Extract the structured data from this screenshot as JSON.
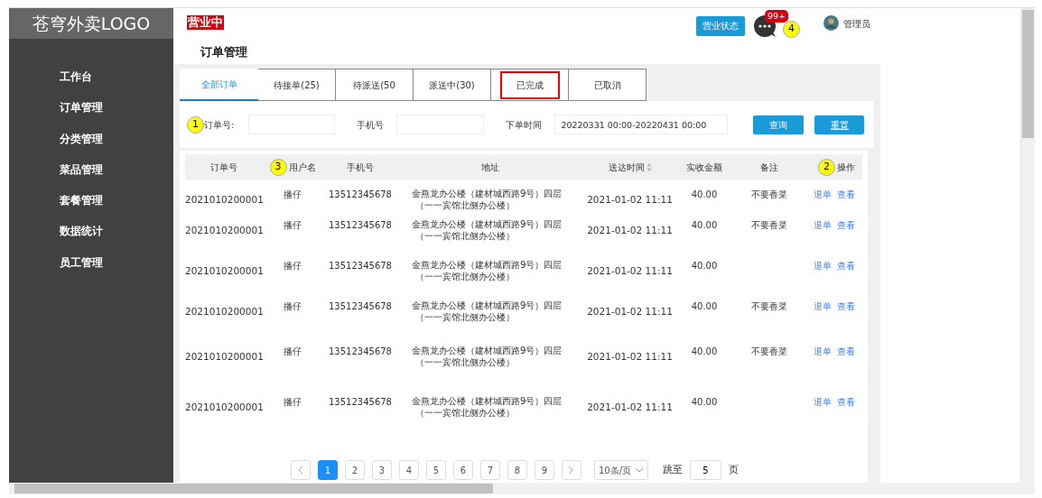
{
  "sidebar": {
    "logo": "苍穹外卖LOGO",
    "items": [
      {
        "label": "工作台",
        "selected": false
      },
      {
        "label": "订单管理",
        "selected": false
      },
      {
        "label": "分类管理",
        "selected": false
      },
      {
        "label": "菜品管理",
        "selected": false
      },
      {
        "label": "套餐管理",
        "selected": false
      },
      {
        "label": "数据统计",
        "selected": false
      },
      {
        "label": "员工管理",
        "selected": false
      }
    ]
  },
  "header": {
    "status_tag": "营业中",
    "page_title": "订单管理",
    "status_button": "营业状态",
    "message_badge": "99+",
    "user": "管理员"
  },
  "tabs": [
    {
      "label": "全部订单",
      "selected": true,
      "marked": false
    },
    {
      "label": "待接单(25)",
      "selected": false,
      "marked": false
    },
    {
      "label": "待派送(50",
      "selected": false,
      "marked": false
    },
    {
      "label": "派送中(30)",
      "selected": false,
      "marked": false
    },
    {
      "label": "已完成",
      "selected": false,
      "marked": true
    },
    {
      "label": "已取消",
      "selected": false,
      "marked": false
    }
  ],
  "filters": {
    "order_label": "订单号:",
    "phone_label": "手机号",
    "time_label": "下单时间",
    "time_value": "20220331 00:00-20220431 00:00",
    "search_button": "查询",
    "reset_button": "重置"
  },
  "table": {
    "columns": [
      "订单号",
      "用户名",
      "手机号",
      "地址",
      "送达时间",
      "实收金额",
      "备注",
      "操作"
    ],
    "rows": [
      {
        "order": "2021010200001",
        "user": "播仔",
        "phone": "13512345678",
        "address": [
          "金燕龙办公楼（建材城西路9号）四层",
          "（一一宾馆北侧办公楼）"
        ],
        "time": "2021-01-02 11:11",
        "amount": "40.00",
        "note": "不要香菜",
        "actions": [
          "退单",
          "查看"
        ]
      },
      {
        "order": "2021010200001",
        "user": "播仔",
        "phone": "13512345678",
        "address": [
          "金燕龙办公楼（建材城西路9号）四层",
          "（一一宾馆北侧办公楼）"
        ],
        "time": "2021-01-02 11:11",
        "amount": "40.00",
        "note": "不要香菜",
        "actions": [
          "退单",
          "查看"
        ]
      },
      {
        "order": "2021010200001",
        "user": "播仔",
        "phone": "13512345678",
        "address": [
          "金燕龙办公楼（建材城西路9号）四层",
          "（一一宾馆北侧办公楼）"
        ],
        "time": "2021-01-02 11:11",
        "amount": "40.00",
        "actions": [
          "退单",
          "查看"
        ]
      },
      {
        "order": "2021010200001",
        "user": "播仔",
        "phone": "13512345678",
        "address": [
          "金燕龙办公楼（建材城西路9号）四层",
          "（一一宾馆北侧办公楼）"
        ],
        "time": "2021-01-02 11:11",
        "amount": "40.00",
        "note": "不要香菜",
        "actions": [
          "退单",
          "查看"
        ]
      },
      {
        "order": "2021010200001",
        "user": "播仔",
        "phone": "13512345678",
        "address": [
          "金燕龙办公楼（建材城西路9号）四层",
          "（一一宾馆北侧办公楼）"
        ],
        "time": "2021-01-02 11:11",
        "amount": "40.00",
        "note": "不要香菜",
        "actions": [
          "退单",
          "查看"
        ]
      },
      {
        "order": "2021010200001",
        "user": "播仔",
        "phone": "13512345678",
        "address": [
          "金燕龙办公楼（建材城西路9号）四层",
          "（一一宾馆北侧办公楼）"
        ],
        "time": "2021-01-02 11:11",
        "amount": "40.00",
        "actions": [
          "退单",
          "查看"
        ]
      }
    ]
  },
  "pagination": {
    "pages": [
      {
        "label": "1",
        "selected": true
      },
      {
        "label": "2",
        "selected": false
      },
      {
        "label": "3",
        "selected": false
      },
      {
        "label": "4",
        "selected": false
      },
      {
        "label": "5",
        "selected": false
      },
      {
        "label": "6",
        "selected": false
      },
      {
        "label": "7",
        "selected": false
      },
      {
        "label": "8",
        "selected": false
      },
      {
        "label": "9",
        "selected": false
      }
    ],
    "page_size": "10条/页",
    "jump_label": "跳至",
    "jump_value": "5",
    "page_unit": "页"
  },
  "annotations": [
    "1",
    "2",
    "3",
    "4"
  ]
}
